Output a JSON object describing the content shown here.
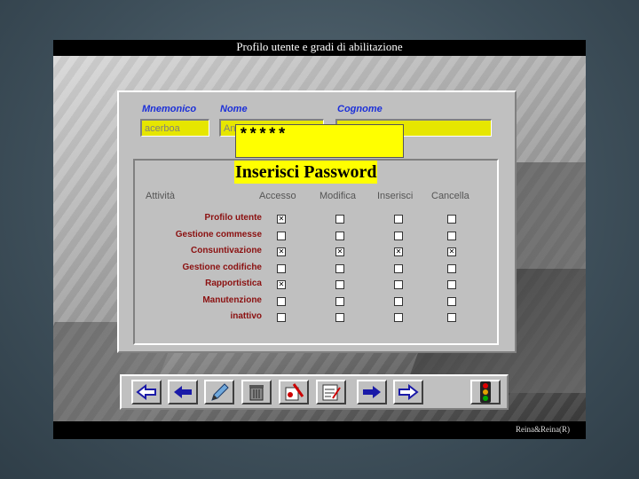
{
  "window": {
    "title": "Profilo utente e gradi di abilitazione",
    "footer": "Reina&Reina(R)"
  },
  "fields": {
    "mnemonico": {
      "label": "Mnemonico",
      "value": "acerboa"
    },
    "nome": {
      "label": "Nome",
      "value": "An"
    },
    "cognome": {
      "label": "Cognome",
      "value": ""
    }
  },
  "password": {
    "value": "*****",
    "label": "Inserisci Password"
  },
  "table": {
    "headers": [
      "Attività",
      "Accesso",
      "Modifica",
      "Inserisci",
      "Cancella"
    ],
    "rows": [
      {
        "label": "Profilo utente",
        "checks": [
          true,
          false,
          false,
          false
        ]
      },
      {
        "label": "Gestione commesse",
        "checks": [
          false,
          false,
          false,
          false
        ]
      },
      {
        "label": "Consuntivazione",
        "checks": [
          true,
          true,
          true,
          true
        ]
      },
      {
        "label": "Gestione codifiche",
        "checks": [
          false,
          false,
          false,
          false
        ]
      },
      {
        "label": "Rapportistica",
        "checks": [
          true,
          false,
          false,
          false
        ]
      },
      {
        "label": "Manutenzione",
        "checks": [
          false,
          false,
          false,
          false
        ]
      },
      {
        "label": "inattivo",
        "checks": [
          false,
          false,
          false,
          false
        ]
      }
    ]
  },
  "toolbar": {
    "buttons": [
      {
        "icon": "back-outline-arrow-icon"
      },
      {
        "icon": "back-arrow-icon"
      },
      {
        "icon": "pencil-icon"
      },
      {
        "icon": "trash-icon"
      },
      {
        "icon": "clear-form-icon"
      },
      {
        "icon": "form-edit-icon"
      },
      {
        "icon": "forward-arrow-icon"
      },
      {
        "icon": "forward-outline-arrow-icon"
      },
      {
        "icon": "traffic-light-icon"
      }
    ]
  },
  "colors": {
    "field_bg": "#e6e600",
    "label_blue": "#1c30d8",
    "row_label": "#8b1010",
    "arrow_blue": "#1a1aa8"
  }
}
